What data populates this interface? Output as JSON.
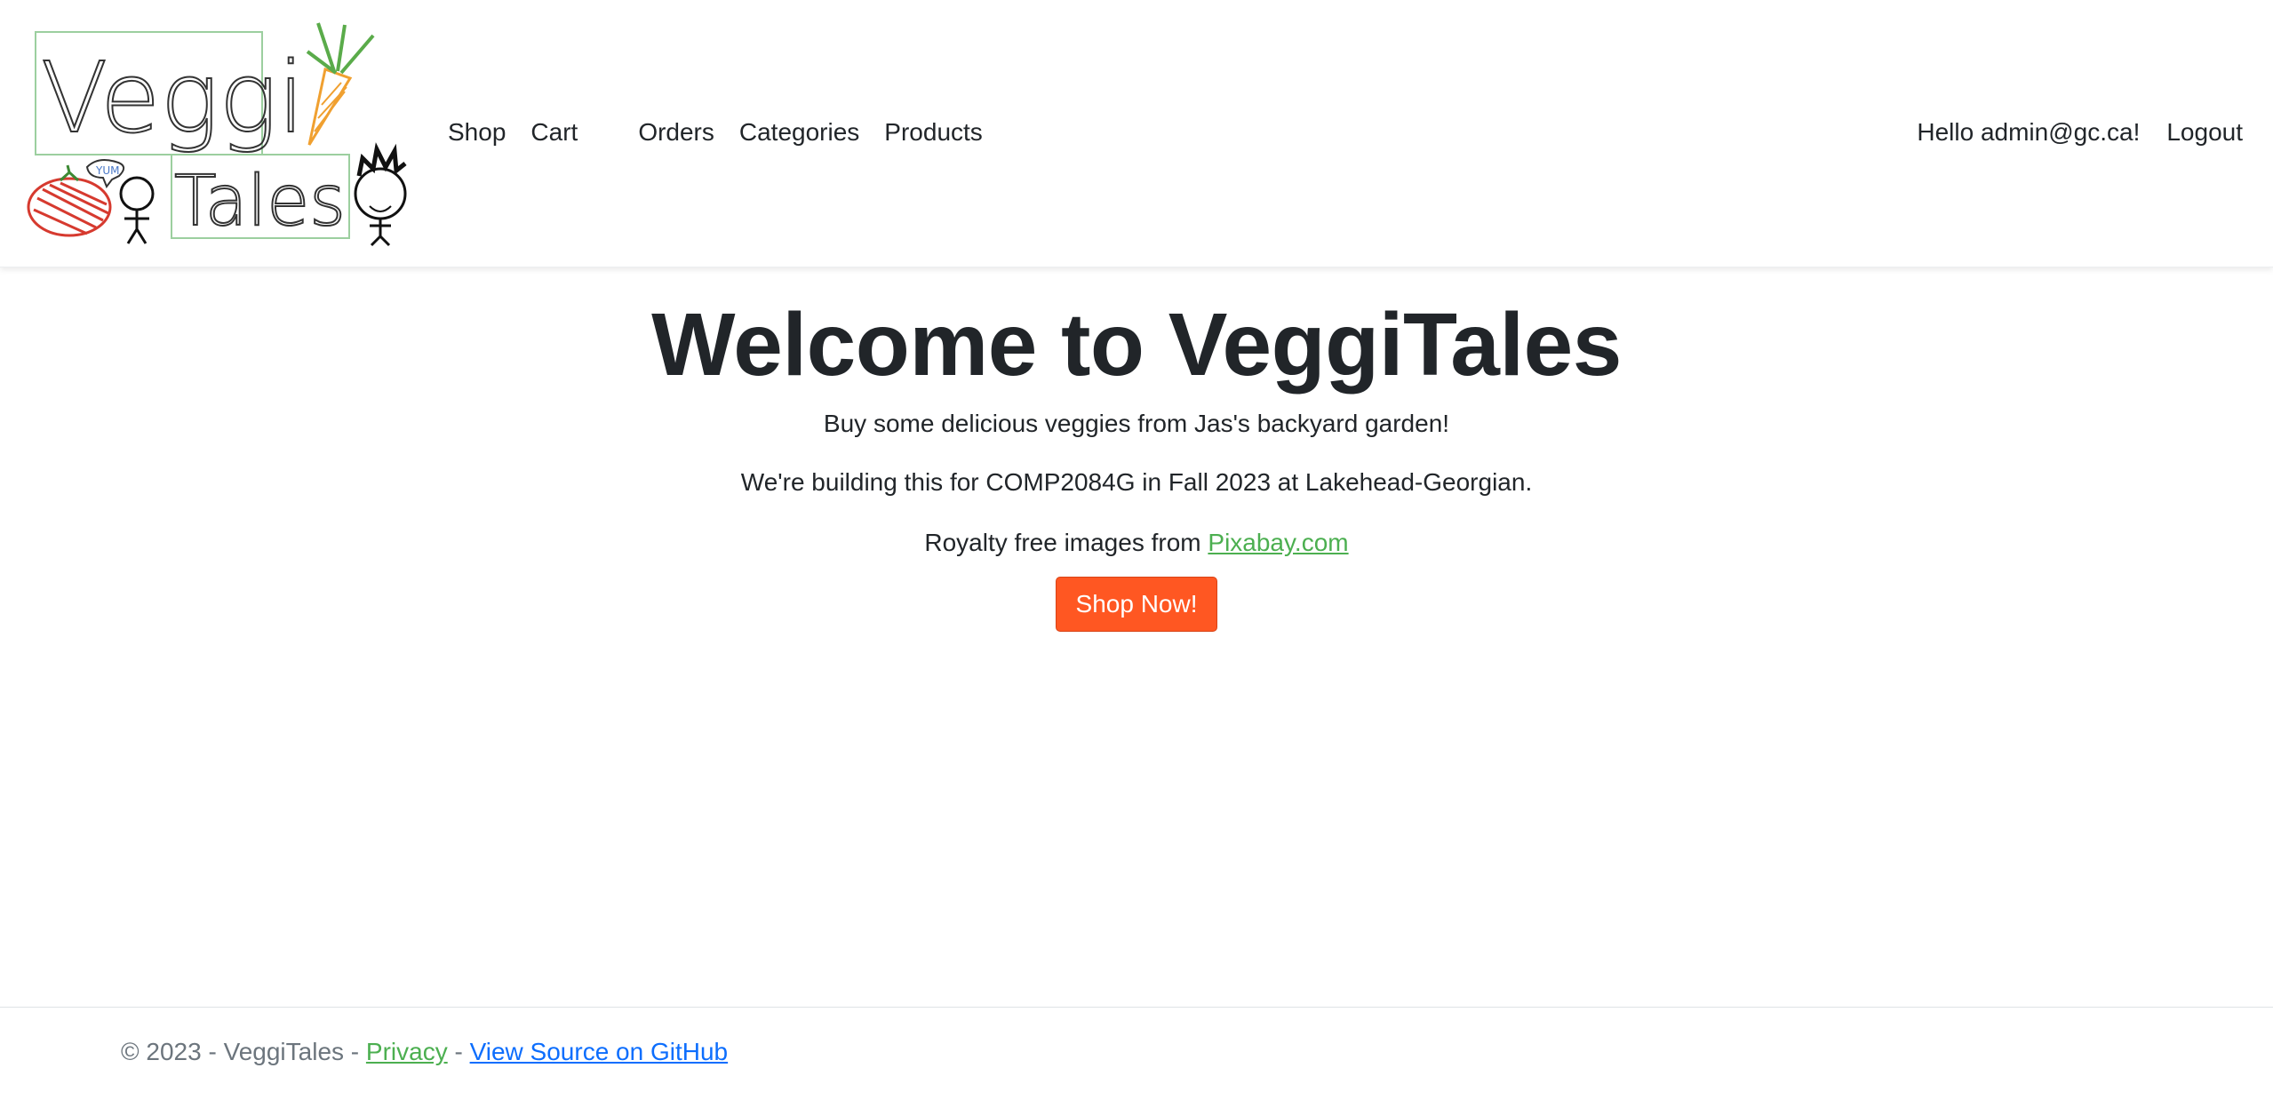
{
  "brand": {
    "logo_text_top": "Veggi",
    "logo_text_bottom": "Tales",
    "logo_bubble": "YUM"
  },
  "nav": {
    "items": [
      {
        "label": "Shop"
      },
      {
        "label": "Cart"
      },
      {
        "label": "Orders"
      },
      {
        "label": "Categories"
      },
      {
        "label": "Products"
      }
    ],
    "greeting": "Hello admin@gc.ca!",
    "logout": "Logout"
  },
  "hero": {
    "title": "Welcome to VeggiTales",
    "line1": "Buy some delicious veggies from Jas's backyard garden!",
    "line2": "We're building this for COMP2084G in Fall 2023 at Lakehead-Georgian.",
    "line3_prefix": "Royalty free images from ",
    "line3_link": "Pixabay.com",
    "button": "Shop Now!"
  },
  "footer": {
    "copyright": "© 2023 - VeggiTales - ",
    "privacy": "Privacy",
    "separator": " - ",
    "github": "View Source on GitHub"
  },
  "colors": {
    "accent_button": "#ff5722",
    "link_green": "#4caf50",
    "link_blue": "#0d6efd",
    "logo_box": "#9ccf9f"
  }
}
